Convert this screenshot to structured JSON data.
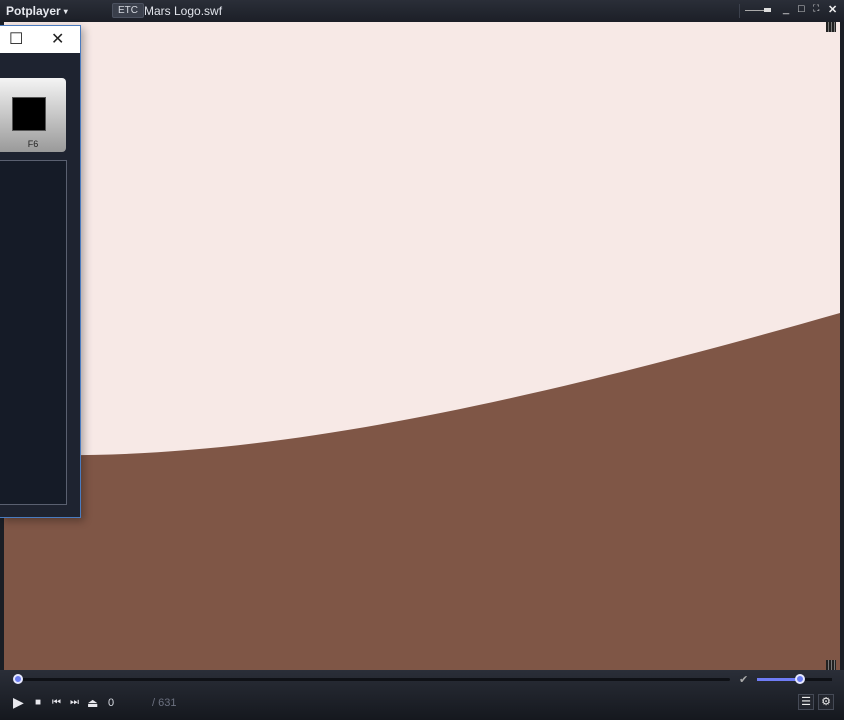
{
  "titlebar": {
    "app_name": "Potplayer",
    "caret": "▾",
    "tag": "ETC",
    "file_title": "Mars Logo.swf",
    "minimize": "_",
    "maximize": "□",
    "fullscreen": "⛶",
    "close": "✕"
  },
  "dialog": {
    "maximize": "☐",
    "close": "✕",
    "button_label": "F6"
  },
  "controls": {
    "play": "▶",
    "stop": "■",
    "prev": "⏮",
    "next": "⏭",
    "eject": "⏏",
    "current_frame": "0",
    "total_frames": "/ 631",
    "playlist": "☰",
    "settings": "⚙",
    "seek_progress": 0,
    "volume_level": 0.57
  },
  "colors": {
    "sky": "#f7e9e6",
    "ground": "#7f5646",
    "accent": "#6a7cf0"
  }
}
